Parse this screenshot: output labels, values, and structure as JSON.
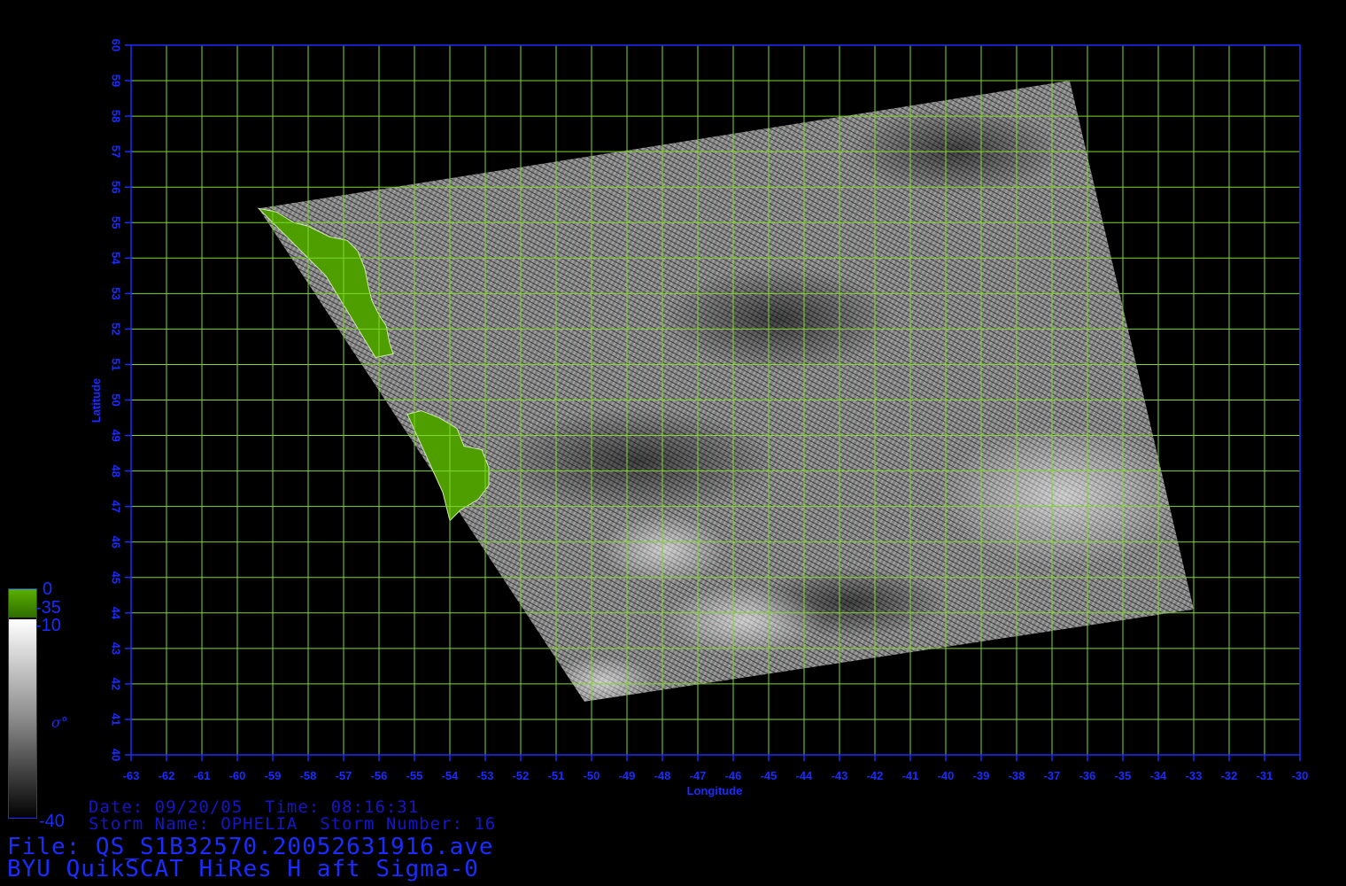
{
  "map": {
    "axes": {
      "x_label": "Longitude",
      "y_label": "Latitude",
      "x_ticks": [
        "-63",
        "-62",
        "-61",
        "-60",
        "-59",
        "-58",
        "-57",
        "-56",
        "-55",
        "-54",
        "-53",
        "-52",
        "-51",
        "-50",
        "-49",
        "-48",
        "-47",
        "-46",
        "-45",
        "-44",
        "-43",
        "-42",
        "-41",
        "-40",
        "-39",
        "-38",
        "-37",
        "-36",
        "-35",
        "-34",
        "-33",
        "-32",
        "-31",
        "-30"
      ],
      "y_ticks": [
        "40",
        "41",
        "42",
        "43",
        "44",
        "45",
        "46",
        "47",
        "48",
        "49",
        "50",
        "51",
        "52",
        "53",
        "54",
        "55",
        "56",
        "57",
        "58",
        "59",
        "60"
      ],
      "x_range": [
        -63,
        -30
      ],
      "y_range": [
        40,
        60
      ],
      "grid": true
    },
    "colors": {
      "grid": "#7fd82a",
      "frame": "#1a2cff",
      "tick_text": "#1a2cff",
      "land": "#4f9e00",
      "background": "#000000"
    },
    "swath_corners_lonlat": [
      [
        -59.4,
        55.4
      ],
      [
        -36.5,
        59.0
      ],
      [
        -33.0,
        44.1
      ],
      [
        -50.2,
        41.5
      ]
    ]
  },
  "colorbar": {
    "land_top_label": "0",
    "land_bottom_label": "-35",
    "top_label": "-10",
    "bottom_label": "-40",
    "symbol": "σ°",
    "land_color": "#4f9e00"
  },
  "info": {
    "date_line": "Date: 09/20/05  Time: 08:16:31",
    "storm_line": "Storm Name: OPHELIA  Storm Number: 16",
    "file_line": "File: QS_S1B32570.20052631916.ave",
    "product_line": "BYU QuikSCAT HiRes H aft Sigma-0"
  }
}
